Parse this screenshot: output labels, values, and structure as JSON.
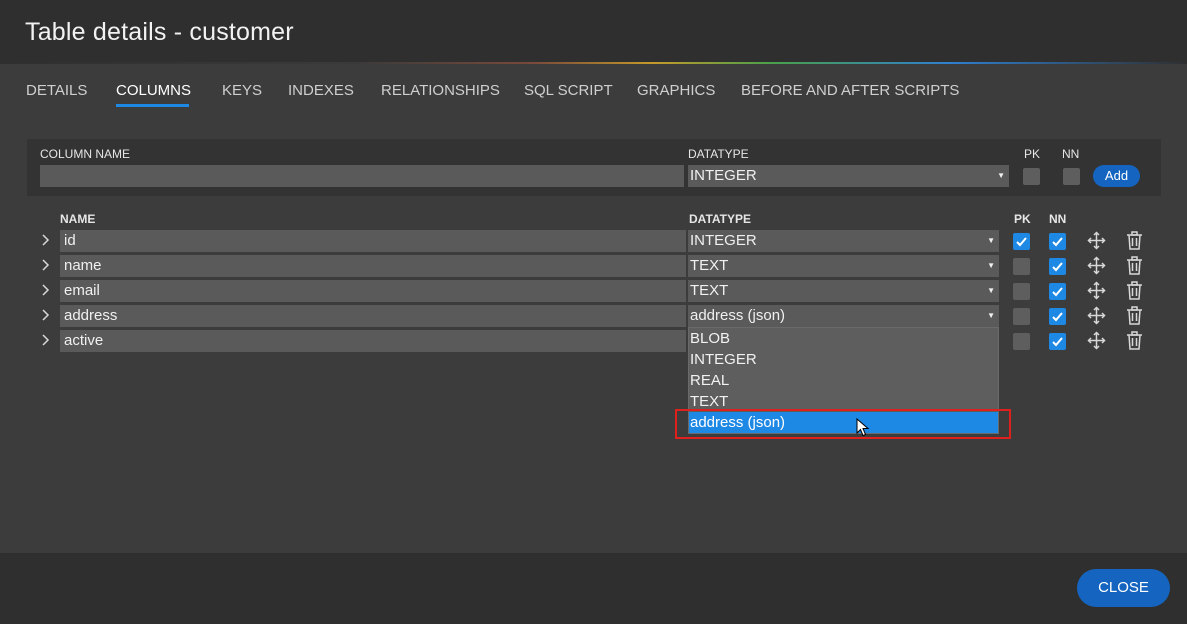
{
  "dialog": {
    "title": "Table details - customer"
  },
  "tabs": [
    {
      "label": "DETAILS"
    },
    {
      "label": "COLUMNS"
    },
    {
      "label": "KEYS"
    },
    {
      "label": "INDEXES"
    },
    {
      "label": "RELATIONSHIPS"
    },
    {
      "label": "SQL SCRIPT"
    },
    {
      "label": "GRAPHICS"
    },
    {
      "label": "BEFORE AND AFTER SCRIPTS"
    }
  ],
  "active_tab": "COLUMNS",
  "new_column": {
    "name_label": "COLUMN NAME",
    "name_value": "",
    "datatype_label": "DATATYPE",
    "datatype_value": "INTEGER",
    "pk_label": "PK",
    "nn_label": "NN",
    "pk_checked": false,
    "nn_checked": false,
    "add_label": "Add"
  },
  "columns_header": {
    "name": "NAME",
    "datatype": "DATATYPE",
    "pk": "PK",
    "nn": "NN"
  },
  "columns": [
    {
      "name": "id",
      "datatype": "INTEGER",
      "pk": true,
      "nn": true
    },
    {
      "name": "name",
      "datatype": "TEXT",
      "pk": false,
      "nn": true
    },
    {
      "name": "email",
      "datatype": "TEXT",
      "pk": false,
      "nn": true
    },
    {
      "name": "address",
      "datatype": "address (json)",
      "pk": false,
      "nn": true
    },
    {
      "name": "active",
      "datatype": "",
      "pk": false,
      "nn": true
    }
  ],
  "datatype_dropdown": {
    "options": [
      "BLOB",
      "INTEGER",
      "REAL",
      "TEXT",
      "address (json)"
    ],
    "selected": "address (json)"
  },
  "footer": {
    "close_label": "CLOSE"
  },
  "colors": {
    "accent": "#1e88e5",
    "button": "#1565c0",
    "highlight": "#e0201c"
  }
}
